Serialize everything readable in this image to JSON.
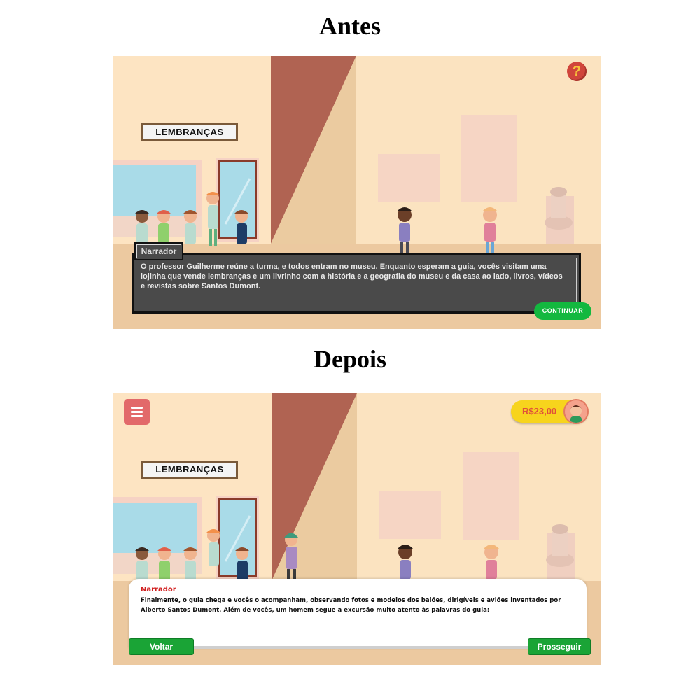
{
  "antes": {
    "title": "Antes",
    "sign": "LEMBRANÇAS",
    "help_icon": "question-icon",
    "narrator_label": "Narrador",
    "narration": "O professor Guilherme reúne a turma, e todos entram no museu. Enquanto esperam a guia, vocês visitam uma lojinha que vende lembranças e um livrinho com a história e a geografia do museu e da casa ao lado, livros, vídeos e revistas sobre Santos Dumont.",
    "continue_label": "CONTINUAR"
  },
  "depois": {
    "title": "Depois",
    "sign": "LEMBRANÇAS",
    "menu_icon": "hamburger-menu-icon",
    "balance": "R$23,00",
    "narrator_label": "Narrador",
    "narration": "Finalmente, o guia chega e vocês o acompanham, observando fotos e modelos dos balões, dirigíveis e aviões inventados por Alberto Santos Dumont. Além de vocês, um homem segue a excursão muito atento às palavras do guia:",
    "back_label": "Voltar",
    "next_label": "Prosseguir"
  },
  "colors": {
    "wall": "#fbe3c0",
    "floor": "#ecc9a0",
    "pillar": "#b06352",
    "green_button": "#1aa436",
    "narrator_red": "#d11f1f",
    "coin_yellow": "#f7d41d"
  }
}
